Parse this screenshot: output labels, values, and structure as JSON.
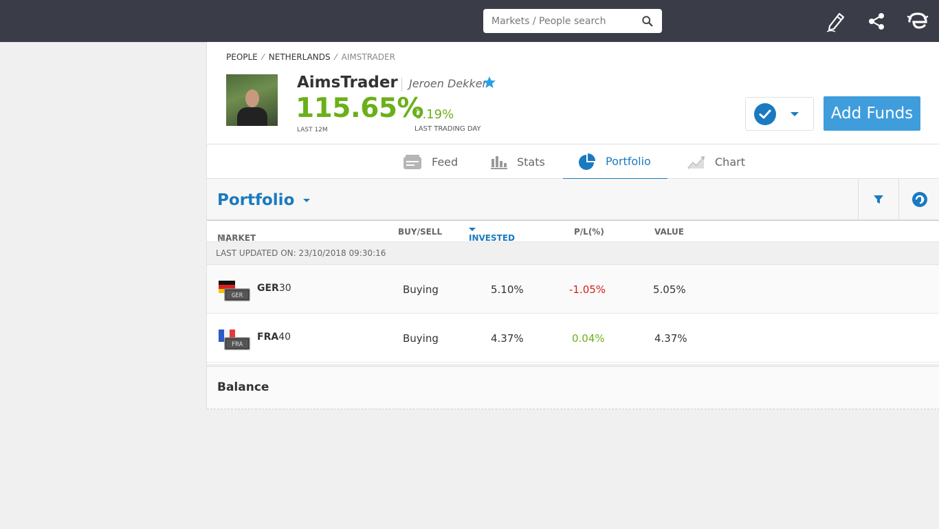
{
  "header": {
    "search": {
      "placeholder": "Markets / People search"
    },
    "icons": [
      "edit-icon",
      "share-icon",
      "etoro-logo-icon"
    ]
  },
  "breadcrumb": [
    "PEOPLE",
    "NETHERLANDS",
    "AIMSTRADER"
  ],
  "profile": {
    "username": "AimsTrader",
    "real_name": "Jeroen Dekker",
    "gain_12m": "115.65%",
    "gain_12m_label": "LAST 12M",
    "gain_day": "0.19%",
    "gain_day_label": "LAST TRADING DAY",
    "add_funds_label": "Add Funds"
  },
  "tabs": [
    {
      "label": "Feed",
      "icon": "feed-icon"
    },
    {
      "label": "Stats",
      "icon": "stats-icon"
    },
    {
      "label": "Portfolio",
      "icon": "pie-chart-icon",
      "active": true
    },
    {
      "label": "Chart",
      "icon": "chart-icon"
    }
  ],
  "portfolio": {
    "title": "Portfolio",
    "columns": {
      "market": "MARKET",
      "market_count": "(2)",
      "buy_sell": "BUY/SELL",
      "invested": "INVESTED",
      "pl": "P/L(%)",
      "value": "VALUE"
    },
    "last_updated": "LAST UPDATED ON: 23/10/2018 09:30:16",
    "rows": [
      {
        "symbol_bold": "GER",
        "symbol_num": "30",
        "flag_label": "GER",
        "action": "Buying",
        "invested": "5.10%",
        "pl": "-1.05%",
        "value": "5.05%"
      },
      {
        "symbol_bold": "FRA",
        "symbol_num": "40",
        "flag_label": "FRA",
        "action": "Buying",
        "invested": "4.37%",
        "pl": "0.04%",
        "value": "4.37%"
      }
    ],
    "balance_label": "Balance"
  },
  "colors": {
    "topbar": "#3a3d48",
    "accent": "#1a7ac0",
    "add_funds": "#3f9ddc",
    "positive": "#6ab01a",
    "negative": "#d81b1b"
  }
}
